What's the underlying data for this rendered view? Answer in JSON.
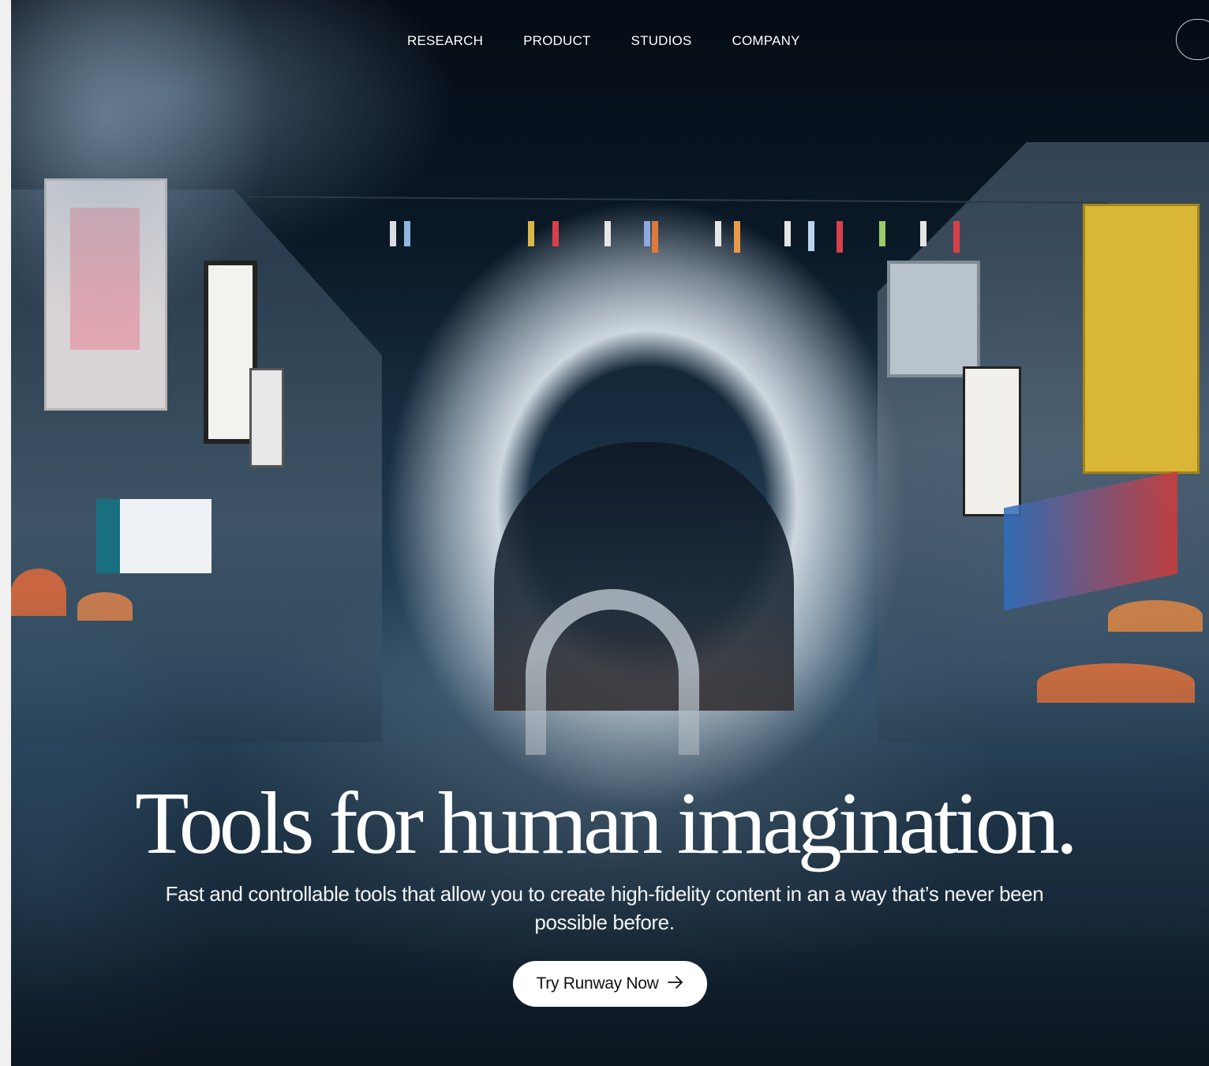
{
  "nav": {
    "items": [
      {
        "label": "RESEARCH"
      },
      {
        "label": "PRODUCT"
      },
      {
        "label": "STUDIOS"
      },
      {
        "label": "COMPANY"
      }
    ]
  },
  "hero": {
    "headline": "Tools for human imagination.",
    "subhead": "Fast and controllable tools that allow you to create high-fidelity content in an a way that’s never been possible before.",
    "cta_label": "Try Runway Now",
    "cta_icon": "arrow-right-icon"
  },
  "colors": {
    "text": "#ffffff",
    "cta_bg": "#ffffff",
    "cta_text": "#111111",
    "page_strip": "#f0f0f0"
  }
}
